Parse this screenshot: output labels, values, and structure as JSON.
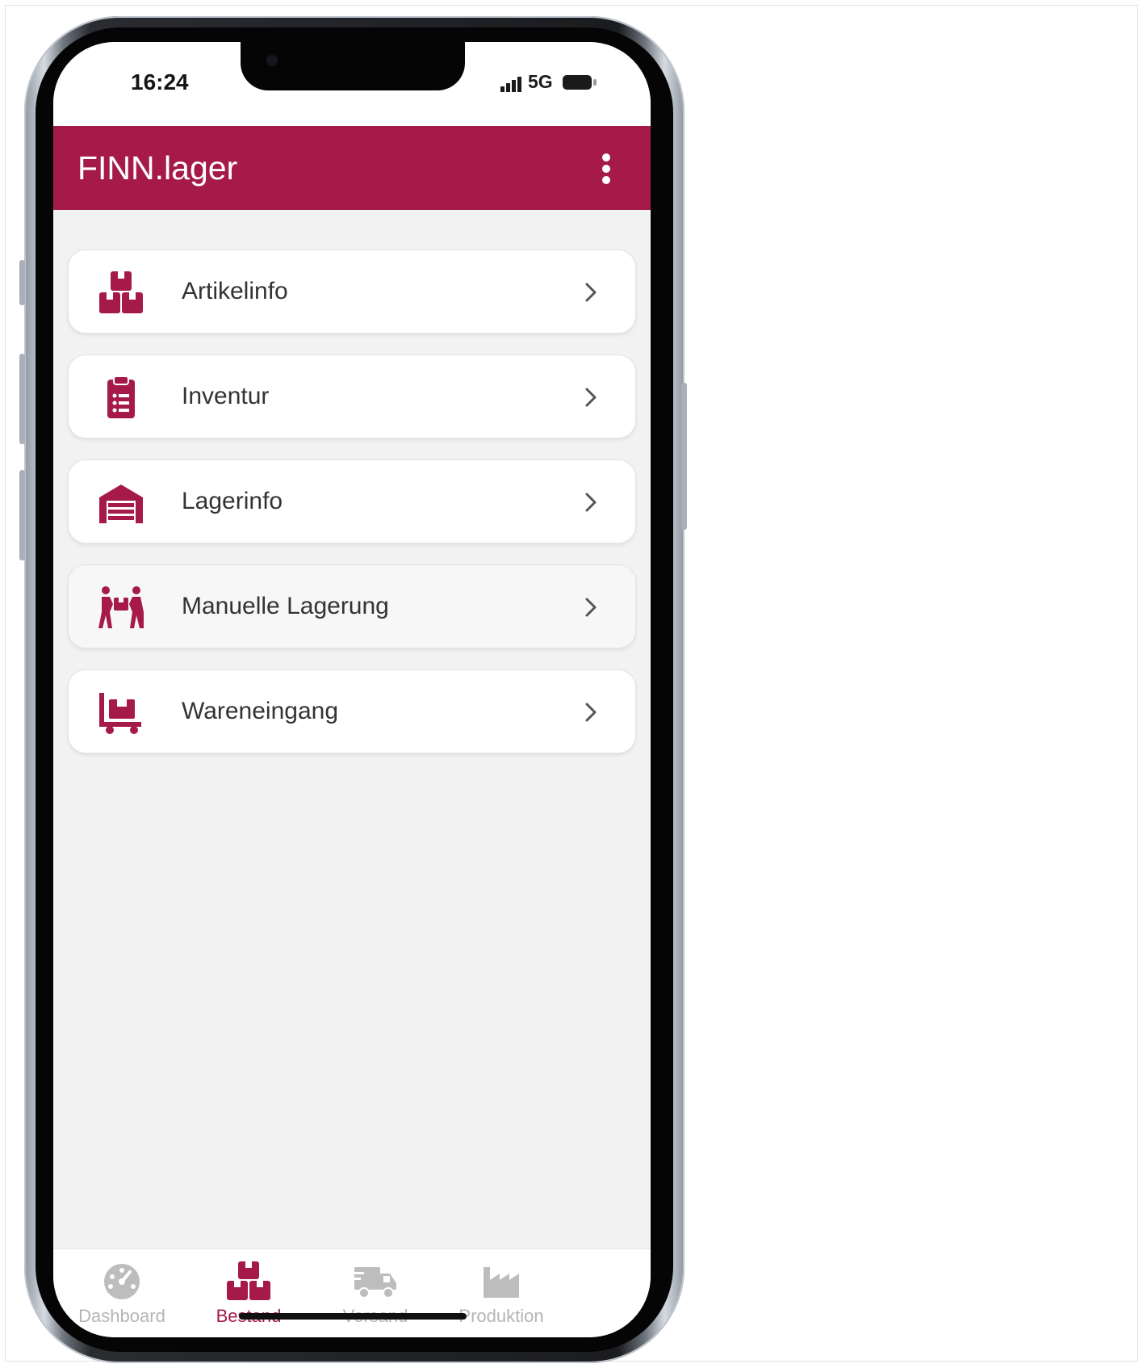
{
  "status_bar": {
    "time": "16:24",
    "network": "5G",
    "icons": [
      "signal-bars-icon",
      "battery-icon"
    ]
  },
  "app_bar": {
    "title": "FINN.lager",
    "menu_icon": "more-vertical-icon"
  },
  "menu": {
    "items": [
      {
        "label": "Artikelinfo",
        "icon": "boxes-icon"
      },
      {
        "label": "Inventur",
        "icon": "clipboard-list-icon"
      },
      {
        "label": "Lagerinfo",
        "icon": "warehouse-icon"
      },
      {
        "label": "Manuelle Lagerung",
        "icon": "people-carry-icon"
      },
      {
        "label": "Wareneingang",
        "icon": "dolly-icon"
      }
    ]
  },
  "bottom_nav": {
    "active": "Bestand",
    "tabs": [
      {
        "label": "Dashboard",
        "icon": "dashboard-gauge-icon"
      },
      {
        "label": "Bestand",
        "icon": "boxes-icon"
      },
      {
        "label": "Versand",
        "icon": "truck-icon"
      },
      {
        "label": "Produktion",
        "icon": "industry-icon"
      }
    ]
  },
  "colors": {
    "accent": "#a51a48",
    "screen_background": "#f2f2f2",
    "card_background": "#ffffff",
    "inactive_tab": "#b5b5b5"
  }
}
